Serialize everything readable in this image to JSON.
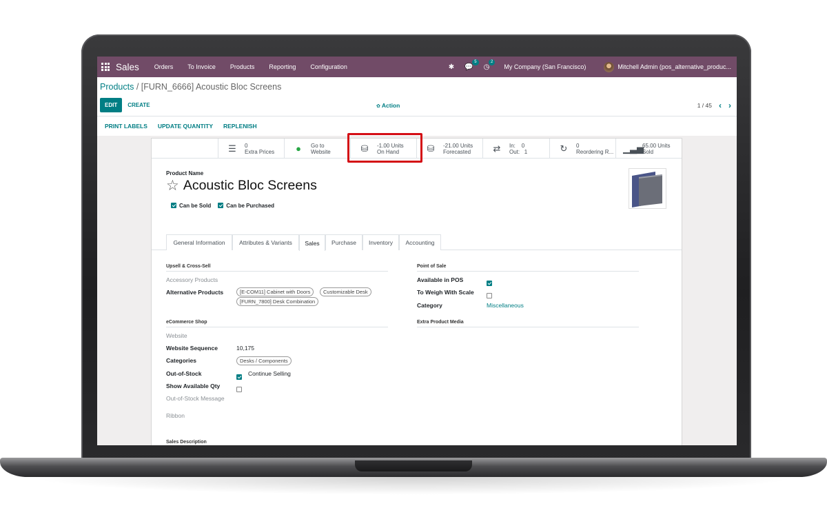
{
  "navbar": {
    "app_name": "Sales",
    "menu": [
      "Orders",
      "To Invoice",
      "Products",
      "Reporting",
      "Configuration"
    ],
    "messages_badge": "5",
    "activities_badge": "2",
    "company": "My Company (San Francisco)",
    "user": "Mitchell Admin (pos_alternative_produc..."
  },
  "breadcrumb": {
    "root": "Products",
    "separator": " / ",
    "current": "[FURN_6666] Acoustic Bloc Screens"
  },
  "toolbar": {
    "edit": "EDIT",
    "create": "CREATE",
    "action": "Action",
    "pager": "1 / 45"
  },
  "statusbar": {
    "print_labels": "PRINT LABELS",
    "update_quantity": "UPDATE QUANTITY",
    "replenish": "REPLENISH"
  },
  "smart_buttons": {
    "extra_prices": {
      "value": "0",
      "label": "Extra Prices"
    },
    "website": {
      "value": "Go to",
      "label": "Website"
    },
    "on_hand": {
      "value": "-1.00 Units",
      "label": "On Hand"
    },
    "forecasted": {
      "value": "-21.00 Units",
      "label": "Forecasted"
    },
    "in_out": {
      "in_label": "In:",
      "in_value": "0",
      "out_label": "Out:",
      "out_value": "1"
    },
    "reordering": {
      "value": "0",
      "label": "Reordering R..."
    },
    "sold": {
      "value": "65.00 Units",
      "label": "Sold"
    }
  },
  "product": {
    "name_label": "Product Name",
    "name": "Acoustic Bloc Screens",
    "can_be_sold": "Can be Sold",
    "can_be_purchased": "Can be Purchased"
  },
  "tabs": [
    "General Information",
    "Attributes & Variants",
    "Sales",
    "Purchase",
    "Inventory",
    "Accounting"
  ],
  "active_tab": "Sales",
  "sales_tab": {
    "upsell_title": "Upsell & Cross-Sell",
    "accessory_products": "Accessory Products",
    "alternative_products": "Alternative Products",
    "alternative_tags": [
      "[E-COM11] Cabinet with Doors",
      "Customizable Desk",
      "[FURN_7800] Desk Combination"
    ],
    "ecommerce_title": "eCommerce Shop",
    "website": "Website",
    "website_sequence_label": "Website Sequence",
    "website_sequence": "10,175",
    "categories_label": "Categories",
    "category_tag": "Desks / Components",
    "out_of_stock_label": "Out-of-Stock",
    "continue_selling": "Continue Selling",
    "show_available_qty": "Show Available Qty",
    "out_of_stock_message": "Out-of-Stock Message",
    "ribbon": "Ribbon",
    "sales_description": "Sales Description",
    "pos_title": "Point of Sale",
    "available_in_pos": "Available in POS",
    "to_weigh": "To Weigh With Scale",
    "category_label": "Category",
    "category_value": "Miscellaneous",
    "extra_media": "Extra Product Media"
  },
  "colors": {
    "navbar": "#714b67",
    "accent": "#017e84",
    "highlight": "#d40e15"
  }
}
